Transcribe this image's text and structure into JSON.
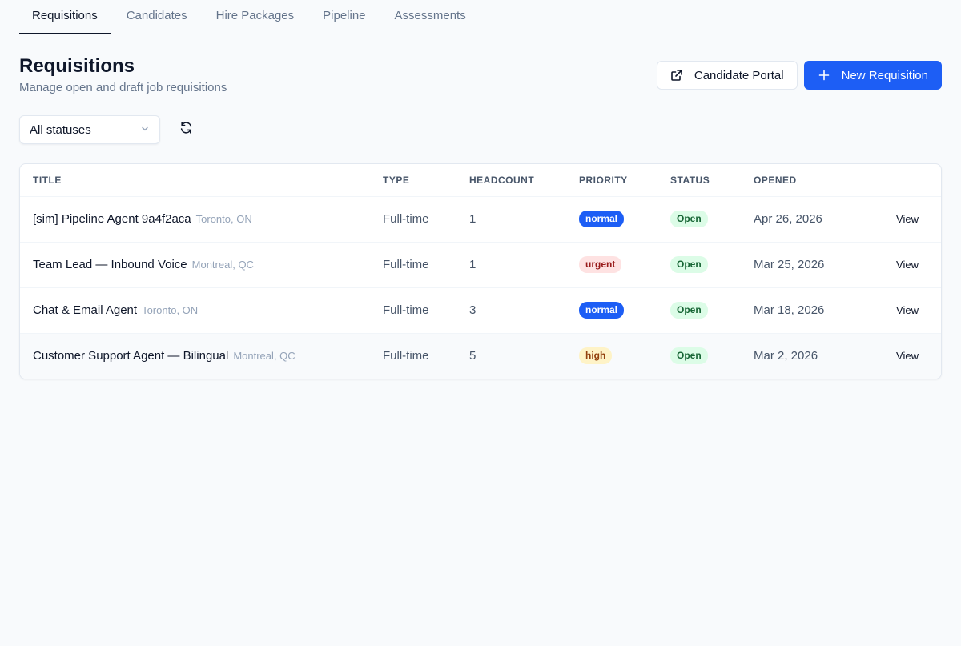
{
  "tabs": [
    {
      "label": "Requisitions",
      "active": true
    },
    {
      "label": "Candidates"
    },
    {
      "label": "Hire Packages"
    },
    {
      "label": "Pipeline"
    },
    {
      "label": "Assessments"
    }
  ],
  "header": {
    "title": "Requisitions",
    "subtitle": "Manage open and draft job requisitions",
    "portal_label": "Candidate Portal",
    "new_label": "New Requisition"
  },
  "filters": {
    "status_value": "All statuses"
  },
  "table": {
    "columns": [
      "TITLE",
      "TYPE",
      "HEADCOUNT",
      "PRIORITY",
      "STATUS",
      "OPENED",
      ""
    ],
    "rows": [
      {
        "title": "[sim] Pipeline Agent 9a4f2aca",
        "location": "Toronto, ON",
        "type": "Full-time",
        "headcount": "1",
        "priority": "normal",
        "status": "Open",
        "opened": "Apr 26, 2026",
        "action": "View"
      },
      {
        "title": "Team Lead — Inbound Voice",
        "location": "Montreal, QC",
        "type": "Full-time",
        "headcount": "1",
        "priority": "urgent",
        "status": "Open",
        "opened": "Mar 25, 2026",
        "action": "View"
      },
      {
        "title": "Chat & Email Agent",
        "location": "Toronto, ON",
        "type": "Full-time",
        "headcount": "3",
        "priority": "normal",
        "status": "Open",
        "opened": "Mar 18, 2026",
        "action": "View"
      },
      {
        "title": "Customer Support Agent — Bilingual",
        "location": "Montreal, QC",
        "type": "Full-time",
        "headcount": "5",
        "priority": "high",
        "status": "Open",
        "opened": "Mar 2, 2026",
        "action": "View"
      }
    ]
  },
  "colors": {
    "primary": "#1d5ef5",
    "urgent_bg": "#fee2e2",
    "high_bg": "#fef3c7",
    "open_bg": "#dcfce7"
  },
  "icons": {
    "portal": "external-link-icon",
    "new": "plus-icon",
    "select": "chevron-down-icon",
    "refresh": "refresh-icon"
  }
}
